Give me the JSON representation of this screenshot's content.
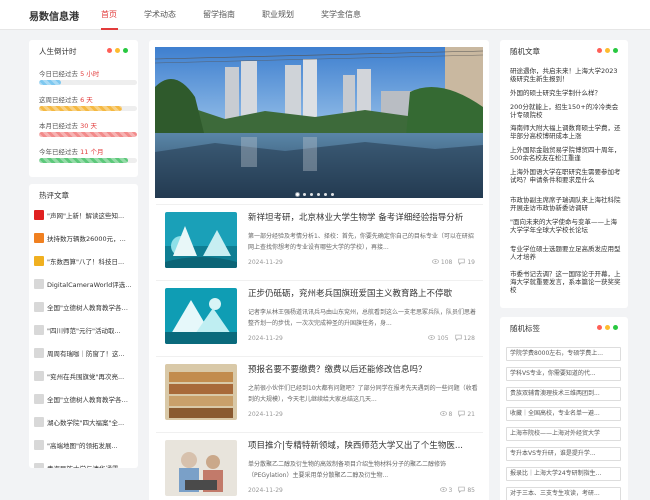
{
  "site": {
    "logo": "易数信息港"
  },
  "nav": [
    {
      "label": "首页",
      "active": true
    },
    {
      "label": "学术动态"
    },
    {
      "label": "留学指南"
    },
    {
      "label": "职业规划"
    },
    {
      "label": "奖学金信息"
    }
  ],
  "stats": {
    "title": "人生倒计时",
    "items": [
      {
        "prefix": "今日已经过去",
        "value": "5",
        "unit": "小时",
        "percent": "22%",
        "fraction": 0.22,
        "color": "#7ec8f0"
      },
      {
        "prefix": "这周已经过去",
        "value": "6",
        "unit": "天",
        "percent": "85%",
        "fraction": 0.85,
        "color": "#f5b942"
      },
      {
        "prefix": "本月已经过去",
        "value": "30",
        "unit": "天",
        "percent": "100%",
        "fraction": 1.0,
        "color": "#f28b8b"
      },
      {
        "prefix": "今年已经过去",
        "value": "11",
        "unit": "个月",
        "percent": "91%",
        "fraction": 0.91,
        "color": "#5cc87a"
      }
    ]
  },
  "recommend": {
    "title": "热评文章",
    "items": [
      {
        "text": "\"声网\"上新！解读这些知...",
        "color": "#e02020"
      },
      {
        "text": "扶持数万辆数26000元，...",
        "color": "#f08020"
      },
      {
        "text": "\"东数西算\"八了！科技日...",
        "color": "#f0b020"
      },
      {
        "text": "DigitalCameraWorld评选2...",
        "color": "#d8d8d8"
      },
      {
        "text": "全国\"立德树人教育教学各行...",
        "color": "#d8d8d8"
      },
      {
        "text": "\"四川师范\"元行\"活动取...",
        "color": "#d8d8d8"
      },
      {
        "text": "周周有瑞咖｜防窗了！这...",
        "color": "#d8d8d8"
      },
      {
        "text": "\"兖州在兵围旗党\"再次亮...",
        "color": "#d8d8d8"
      },
      {
        "text": "全国\"立德树人教育教学各行...",
        "color": "#d8d8d8"
      },
      {
        "text": "湖心数学院\"四大福案\"全...",
        "color": "#d8d8d8"
      },
      {
        "text": "\"高端地图\"的领拓发展...",
        "color": "#d8d8d8"
      },
      {
        "text": "青海民族大学与清华通霸...",
        "color": "#d8d8d8"
      }
    ]
  },
  "posts": [
    {
      "title": "新祥坦考研，北京林业大学生物学 备考详细经验指导分析",
      "summary": "第一部分经验及考情分析1、择校：首先，你要先确定你自己的目标专业（可以在研招网上查找你想考的专业设有哪些大学的学校），再接...",
      "date": "2024-11-29",
      "views": "108",
      "comments": "19"
    },
    {
      "title": "正步仍砥砺，兖州老兵国旗班爱国主义教育路上不停歇",
      "summary": "记者李从林王强杨道讯讯兵马由山东兖州，总航看到这么一支老思冢兵队，队员们思着整齐划一的步伐，一次次完成神圣的升国旗任务，身...",
      "date": "2024-11-29",
      "views": "105",
      "comments": "128"
    },
    {
      "title": "预报名要不要缴费？缴费以后还能修改信息吗？",
      "summary": "之前很小伙伴们已经到10大都有问题吧？了部分同学在报考先天遇到的一些问题（收看到的大规模），今天老儿继续给大家总结这几天...",
      "date": "2024-11-29",
      "views": "8",
      "comments": "21"
    },
    {
      "title": "项目推介|专精特新领域，陕西师范大学又出了个生物医...",
      "summary": "单分散聚乙二醇及衍生物的高效制备项目介绍生物材料分子的聚乙二醇修饰（PEGylation）主要采用单分散聚乙二醇及衍生物...",
      "date": "2024-11-29",
      "views": "3",
      "comments": "85"
    }
  ],
  "random": {
    "title": "随机文章",
    "items": [
      "研途遇你，共启未来！上海大学2023级研究生新生报到！",
      "外国的硕士研究生学制什么样？",
      "200分就能上，招生150+的冷冷类会计专硕院校",
      "海南师大附大福上调数育硕士学费，还毕部分高校博研成本上涨",
      "上外国际金融贸易学院博贸四十周年，500余名校友在松江重逢",
      "上海外国语大学在职研究生需要参加考试吗？申请条件和要求是什么",
      "市政协副主席席子瑞调队来上海社科院开展走访市政协新委访调研",
      "\"面向未来的大学使命与变革——上海大学学年全球大学校长论坛",
      "专业学位硕士选题要立足高质发应用型人才培养",
      "市委书记去调？这一国际论于开幕，上海大学就重要发言，系本篇论一获奖奖校"
    ]
  },
  "tags": {
    "title": "随机标签",
    "items": [
      "学院学费8000左右，专硕学费上...",
      "学科VS专业，你需要知道的代...",
      "贵族双辅青澳理技术三维两团到...",
      "收藏｜全国高校，专业名单一避...",
      "上海市院校——上海对外经贸大学",
      "专升本VS专升研，谁是提升学...",
      "报录比｜上海大学24专研制指生...",
      "对于三本、三支专生攻读，考研..."
    ]
  },
  "colors": {
    "accent": "#e23b3b",
    "dot_red": "#ff5f57",
    "dot_yellow": "#febc2e",
    "dot_green": "#28c840"
  }
}
